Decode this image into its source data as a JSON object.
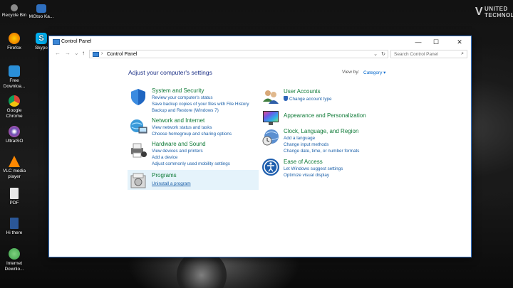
{
  "desktop": {
    "watermark": "UNITED TECHNOLOGY",
    "watermark_letter": "V",
    "icons": [
      {
        "label": "Recycle Bin",
        "color": "#8a8a8a"
      },
      {
        "label": "MGtoo Ka...",
        "color": "#2f6fbf"
      },
      {
        "label": "Firefox",
        "color": "#e66000"
      },
      {
        "label": "Skype",
        "color": "#00aff0"
      },
      {
        "label": "Free Downloa...",
        "color": "#2a8fd8"
      },
      {
        "label": "Google Chrome",
        "color": "#db4437"
      },
      {
        "label": "UltraISO",
        "color": "#6b4fb3"
      },
      {
        "label": "VLC media player",
        "color": "#ff8800"
      },
      {
        "label": "PDF",
        "color": "#e8e8e8"
      },
      {
        "label": "Hi there",
        "color": "#2b5797"
      },
      {
        "label": "Internet Downlo...",
        "color": "#3da24b"
      }
    ]
  },
  "window": {
    "title": "Control Panel",
    "minimize": "—",
    "maximize": "☐",
    "close": "✕"
  },
  "addressbar": {
    "back": "←",
    "forward": "→",
    "recent": "⌄",
    "up": "↑",
    "separator": "›",
    "path": "Control Panel",
    "dropdown": "⌄",
    "refresh": "↻",
    "search_placeholder": "Search Control Panel",
    "search_icon": "⌕"
  },
  "content": {
    "heading": "Adjust your computer's settings",
    "view_by_label": "View by:",
    "view_by_value": "Category ▾",
    "left_categories": [
      {
        "title": "System and Security",
        "icon": "shield-icon",
        "links": [
          "Review your computer's status",
          "Save backup copies of your files with File History",
          "Backup and Restore (Windows 7)"
        ]
      },
      {
        "title": "Network and Internet",
        "icon": "network-icon",
        "links": [
          "View network status and tasks",
          "Choose homegroup and sharing options"
        ]
      },
      {
        "title": "Hardware and Sound",
        "icon": "printer-icon",
        "links": [
          "View devices and printers",
          "Add a device",
          "Adjust commonly used mobility settings"
        ]
      },
      {
        "title": "Programs",
        "icon": "programs-icon",
        "links": [
          "Uninstall a program"
        ]
      }
    ],
    "right_categories": [
      {
        "title": "User Accounts",
        "icon": "users-icon",
        "links": [
          "Change account type"
        ]
      },
      {
        "title": "Appearance and Personalization",
        "icon": "monitor-icon",
        "links": []
      },
      {
        "title": "Clock, Language, and Region",
        "icon": "clock-icon",
        "links": [
          "Add a language",
          "Change input methods",
          "Change date, time, or number formats"
        ]
      },
      {
        "title": "Ease of Access",
        "icon": "ease-of-access-icon",
        "links": [
          "Let Windows suggest settings",
          "Optimize visual display"
        ]
      }
    ]
  }
}
